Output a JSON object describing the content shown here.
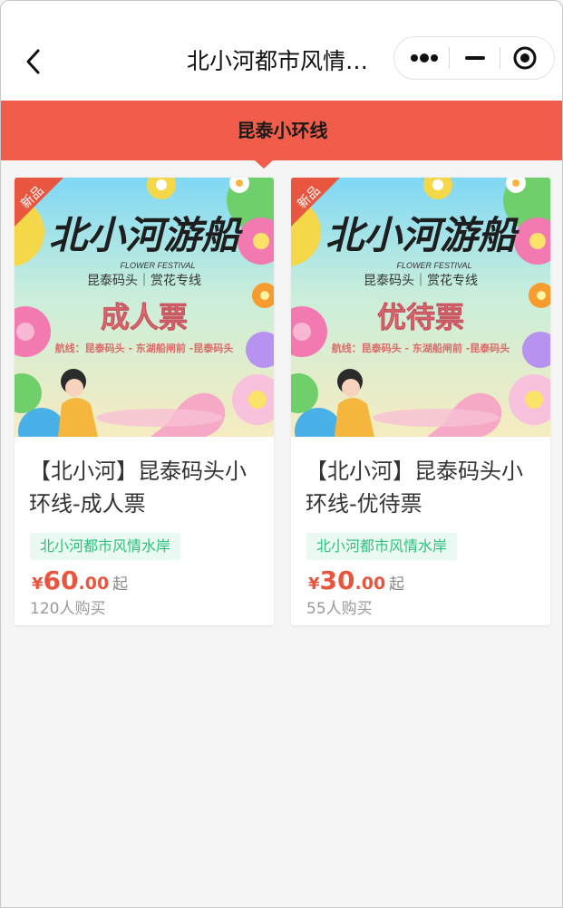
{
  "navbar": {
    "title": "北小河都市风情水岸",
    "back_icon": "chevron-left-icon",
    "capsule": {
      "more_icon": "more-dots-icon",
      "minimize_icon": "minus-icon",
      "close_icon": "target-icon"
    }
  },
  "tabs": [
    {
      "label": "昆泰小环线",
      "active": true
    }
  ],
  "colors": {
    "accent": "#f15d4a",
    "price": "#e8563f",
    "tag_text": "#2fbf7f",
    "tag_bg": "#eafaf3"
  },
  "products": [
    {
      "badge": "新品",
      "poster": {
        "headline": "北小河游船",
        "festival": "FLOWER FESTIVAL",
        "subtitle": "昆泰码头｜赏花专线",
        "ticket": "成人票",
        "route": "航线：昆泰码头 - 东湖船闸前 -昆泰码头"
      },
      "title": "【北小河】昆泰码头小环线-成人票",
      "tag": "北小河都市风情水岸",
      "price": {
        "currency": "¥",
        "integer": "60",
        "decimal": ".00",
        "suffix": "起"
      },
      "sold": "120人购买"
    },
    {
      "badge": "新品",
      "poster": {
        "headline": "北小河游船",
        "festival": "FLOWER FESTIVAL",
        "subtitle": "昆泰码头｜赏花专线",
        "ticket": "优待票",
        "route": "航线：昆泰码头 - 东湖船闸前 -昆泰码头"
      },
      "title": "【北小河】昆泰码头小环线-优待票",
      "tag": "北小河都市风情水岸",
      "price": {
        "currency": "¥",
        "integer": "30",
        "decimal": ".00",
        "suffix": "起"
      },
      "sold": "55人购买"
    }
  ]
}
